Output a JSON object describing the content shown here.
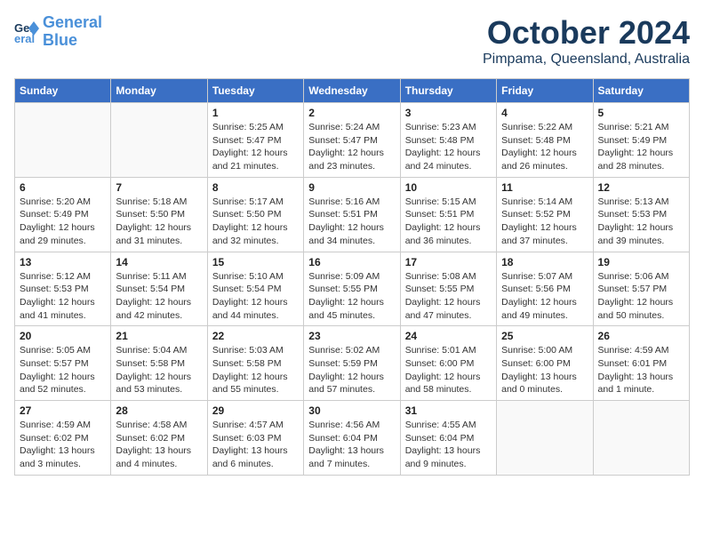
{
  "logo": {
    "line1": "General",
    "line2": "Blue"
  },
  "title": "October 2024",
  "location": "Pimpama, Queensland, Australia",
  "days_of_week": [
    "Sunday",
    "Monday",
    "Tuesday",
    "Wednesday",
    "Thursday",
    "Friday",
    "Saturday"
  ],
  "weeks": [
    [
      {
        "day": "",
        "detail": ""
      },
      {
        "day": "",
        "detail": ""
      },
      {
        "day": "1",
        "detail": "Sunrise: 5:25 AM\nSunset: 5:47 PM\nDaylight: 12 hours\nand 21 minutes."
      },
      {
        "day": "2",
        "detail": "Sunrise: 5:24 AM\nSunset: 5:47 PM\nDaylight: 12 hours\nand 23 minutes."
      },
      {
        "day": "3",
        "detail": "Sunrise: 5:23 AM\nSunset: 5:48 PM\nDaylight: 12 hours\nand 24 minutes."
      },
      {
        "day": "4",
        "detail": "Sunrise: 5:22 AM\nSunset: 5:48 PM\nDaylight: 12 hours\nand 26 minutes."
      },
      {
        "day": "5",
        "detail": "Sunrise: 5:21 AM\nSunset: 5:49 PM\nDaylight: 12 hours\nand 28 minutes."
      }
    ],
    [
      {
        "day": "6",
        "detail": "Sunrise: 5:20 AM\nSunset: 5:49 PM\nDaylight: 12 hours\nand 29 minutes."
      },
      {
        "day": "7",
        "detail": "Sunrise: 5:18 AM\nSunset: 5:50 PM\nDaylight: 12 hours\nand 31 minutes."
      },
      {
        "day": "8",
        "detail": "Sunrise: 5:17 AM\nSunset: 5:50 PM\nDaylight: 12 hours\nand 32 minutes."
      },
      {
        "day": "9",
        "detail": "Sunrise: 5:16 AM\nSunset: 5:51 PM\nDaylight: 12 hours\nand 34 minutes."
      },
      {
        "day": "10",
        "detail": "Sunrise: 5:15 AM\nSunset: 5:51 PM\nDaylight: 12 hours\nand 36 minutes."
      },
      {
        "day": "11",
        "detail": "Sunrise: 5:14 AM\nSunset: 5:52 PM\nDaylight: 12 hours\nand 37 minutes."
      },
      {
        "day": "12",
        "detail": "Sunrise: 5:13 AM\nSunset: 5:53 PM\nDaylight: 12 hours\nand 39 minutes."
      }
    ],
    [
      {
        "day": "13",
        "detail": "Sunrise: 5:12 AM\nSunset: 5:53 PM\nDaylight: 12 hours\nand 41 minutes."
      },
      {
        "day": "14",
        "detail": "Sunrise: 5:11 AM\nSunset: 5:54 PM\nDaylight: 12 hours\nand 42 minutes."
      },
      {
        "day": "15",
        "detail": "Sunrise: 5:10 AM\nSunset: 5:54 PM\nDaylight: 12 hours\nand 44 minutes."
      },
      {
        "day": "16",
        "detail": "Sunrise: 5:09 AM\nSunset: 5:55 PM\nDaylight: 12 hours\nand 45 minutes."
      },
      {
        "day": "17",
        "detail": "Sunrise: 5:08 AM\nSunset: 5:55 PM\nDaylight: 12 hours\nand 47 minutes."
      },
      {
        "day": "18",
        "detail": "Sunrise: 5:07 AM\nSunset: 5:56 PM\nDaylight: 12 hours\nand 49 minutes."
      },
      {
        "day": "19",
        "detail": "Sunrise: 5:06 AM\nSunset: 5:57 PM\nDaylight: 12 hours\nand 50 minutes."
      }
    ],
    [
      {
        "day": "20",
        "detail": "Sunrise: 5:05 AM\nSunset: 5:57 PM\nDaylight: 12 hours\nand 52 minutes."
      },
      {
        "day": "21",
        "detail": "Sunrise: 5:04 AM\nSunset: 5:58 PM\nDaylight: 12 hours\nand 53 minutes."
      },
      {
        "day": "22",
        "detail": "Sunrise: 5:03 AM\nSunset: 5:58 PM\nDaylight: 12 hours\nand 55 minutes."
      },
      {
        "day": "23",
        "detail": "Sunrise: 5:02 AM\nSunset: 5:59 PM\nDaylight: 12 hours\nand 57 minutes."
      },
      {
        "day": "24",
        "detail": "Sunrise: 5:01 AM\nSunset: 6:00 PM\nDaylight: 12 hours\nand 58 minutes."
      },
      {
        "day": "25",
        "detail": "Sunrise: 5:00 AM\nSunset: 6:00 PM\nDaylight: 13 hours\nand 0 minutes."
      },
      {
        "day": "26",
        "detail": "Sunrise: 4:59 AM\nSunset: 6:01 PM\nDaylight: 13 hours\nand 1 minute."
      }
    ],
    [
      {
        "day": "27",
        "detail": "Sunrise: 4:59 AM\nSunset: 6:02 PM\nDaylight: 13 hours\nand 3 minutes."
      },
      {
        "day": "28",
        "detail": "Sunrise: 4:58 AM\nSunset: 6:02 PM\nDaylight: 13 hours\nand 4 minutes."
      },
      {
        "day": "29",
        "detail": "Sunrise: 4:57 AM\nSunset: 6:03 PM\nDaylight: 13 hours\nand 6 minutes."
      },
      {
        "day": "30",
        "detail": "Sunrise: 4:56 AM\nSunset: 6:04 PM\nDaylight: 13 hours\nand 7 minutes."
      },
      {
        "day": "31",
        "detail": "Sunrise: 4:55 AM\nSunset: 6:04 PM\nDaylight: 13 hours\nand 9 minutes."
      },
      {
        "day": "",
        "detail": ""
      },
      {
        "day": "",
        "detail": ""
      }
    ]
  ]
}
